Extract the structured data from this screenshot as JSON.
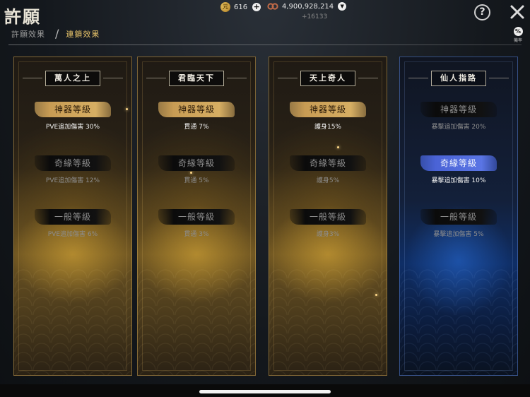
{
  "app": {
    "title": "許願"
  },
  "breadcrumb": {
    "tabs": [
      {
        "label": "許願效果",
        "active": false
      },
      {
        "label": "連鎖效果",
        "active": true
      }
    ],
    "separator": "/"
  },
  "currencies": {
    "gem": {
      "value": "616",
      "icon": "coin-icon",
      "action": "+"
    },
    "silver": {
      "value": "4,900,928,214",
      "icon": "chain-coin-icon",
      "action": "▼",
      "delta": "+16133"
    }
  },
  "actions": {
    "help": "?",
    "rate_icon": "%",
    "rate_label": "機率"
  },
  "colors": {
    "gold_accent": "#d6ae63",
    "blue_accent": "#4a63d6",
    "active_tab": "#e8c46a"
  },
  "cards": [
    {
      "title": "萬人之上",
      "theme": "gold",
      "tiers": [
        {
          "label": "神器等級",
          "value": "PVE追加傷害 30%",
          "active": true
        },
        {
          "label": "奇緣等級",
          "value": "PVE追加傷害 12%",
          "active": false
        },
        {
          "label": "一般等級",
          "value": "PVE追加傷害 6%",
          "active": false
        }
      ]
    },
    {
      "title": "君臨天下",
      "theme": "gold",
      "tiers": [
        {
          "label": "神器等級",
          "value": "貫通 7%",
          "active": true
        },
        {
          "label": "奇緣等級",
          "value": "貫通 5%",
          "active": false
        },
        {
          "label": "一般等級",
          "value": "貫通 3%",
          "active": false
        }
      ]
    },
    {
      "title": "天上奇人",
      "theme": "gold",
      "tiers": [
        {
          "label": "神器等級",
          "value": "護身15%",
          "active": true
        },
        {
          "label": "奇緣等級",
          "value": "護身5%",
          "active": false
        },
        {
          "label": "一般等級",
          "value": "護身3%",
          "active": false
        }
      ]
    },
    {
      "title": "仙人指路",
      "theme": "blue",
      "tiers": [
        {
          "label": "神器等級",
          "value": "暴擊追加傷害 20%",
          "active": false
        },
        {
          "label": "奇緣等級",
          "value": "暴擊追加傷害 10%",
          "active": true
        },
        {
          "label": "一般等級",
          "value": "暴擊追加傷害 5%",
          "active": false
        }
      ]
    }
  ]
}
